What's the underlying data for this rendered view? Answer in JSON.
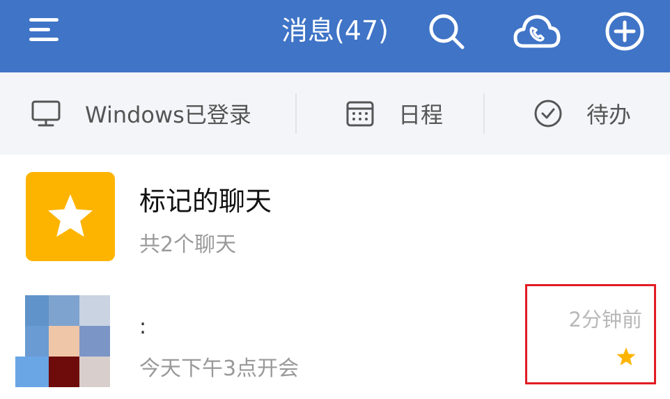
{
  "header": {
    "title": "消息(47)",
    "menu_icon": "menu-icon",
    "search_icon": "search-icon",
    "cloud_call_icon": "cloud-phone-icon",
    "add_icon": "plus-circle-icon",
    "background_color": "#3f74c7"
  },
  "quick_bar": {
    "windows": {
      "icon": "monitor-icon",
      "label": "Windows已登录"
    },
    "schedule": {
      "icon": "calendar-icon",
      "label": "日程"
    },
    "todo": {
      "icon": "check-circle-icon",
      "label": "待办"
    }
  },
  "chats": [
    {
      "title": "标记的聊天",
      "subtitle": "共2个聊天",
      "avatar_icon": "star-icon",
      "avatar_color": "#fdb400"
    },
    {
      "name": ":",
      "preview": "今天下午3点开会",
      "time": "2分钟前",
      "starred": true,
      "star_color": "#fdb400",
      "avatar": "pixelated-photo"
    }
  ],
  "highlight_color": "#e11c23"
}
